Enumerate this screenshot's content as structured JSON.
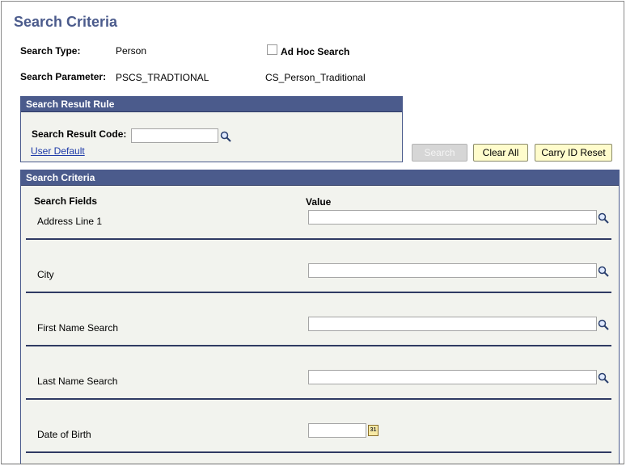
{
  "page": {
    "title": "Search Criteria"
  },
  "header": {
    "search_type_label": "Search Type:",
    "search_type_value": "Person",
    "adhoc_label": "Ad Hoc Search",
    "search_param_label": "Search Parameter:",
    "search_param_value": "PSCS_TRADTIONAL",
    "search_param_desc": "CS_Person_Traditional"
  },
  "result_rule": {
    "heading": "Search Result Rule",
    "code_label": "Search Result Code:",
    "code_value": "",
    "user_default_link": "User Default"
  },
  "buttons": {
    "search": "Search",
    "clear_all": "Clear All",
    "carry_id_reset": "Carry ID Reset"
  },
  "criteria": {
    "heading": "Search Criteria",
    "col_fields": "Search Fields",
    "col_value": "Value",
    "fields": [
      {
        "label": "Address Line 1",
        "value": ""
      },
      {
        "label": "City",
        "value": ""
      },
      {
        "label": "First Name Search",
        "value": ""
      },
      {
        "label": "Last Name Search",
        "value": ""
      },
      {
        "label": "Date of Birth",
        "value": ""
      }
    ],
    "calendar_glyph": "31"
  },
  "colors": {
    "title": "#4b5b8c",
    "group_header": "#4b5b8c",
    "group_bg": "#f2f3ee",
    "button_yellow": "#fffccc",
    "link": "#1d3aa8"
  }
}
